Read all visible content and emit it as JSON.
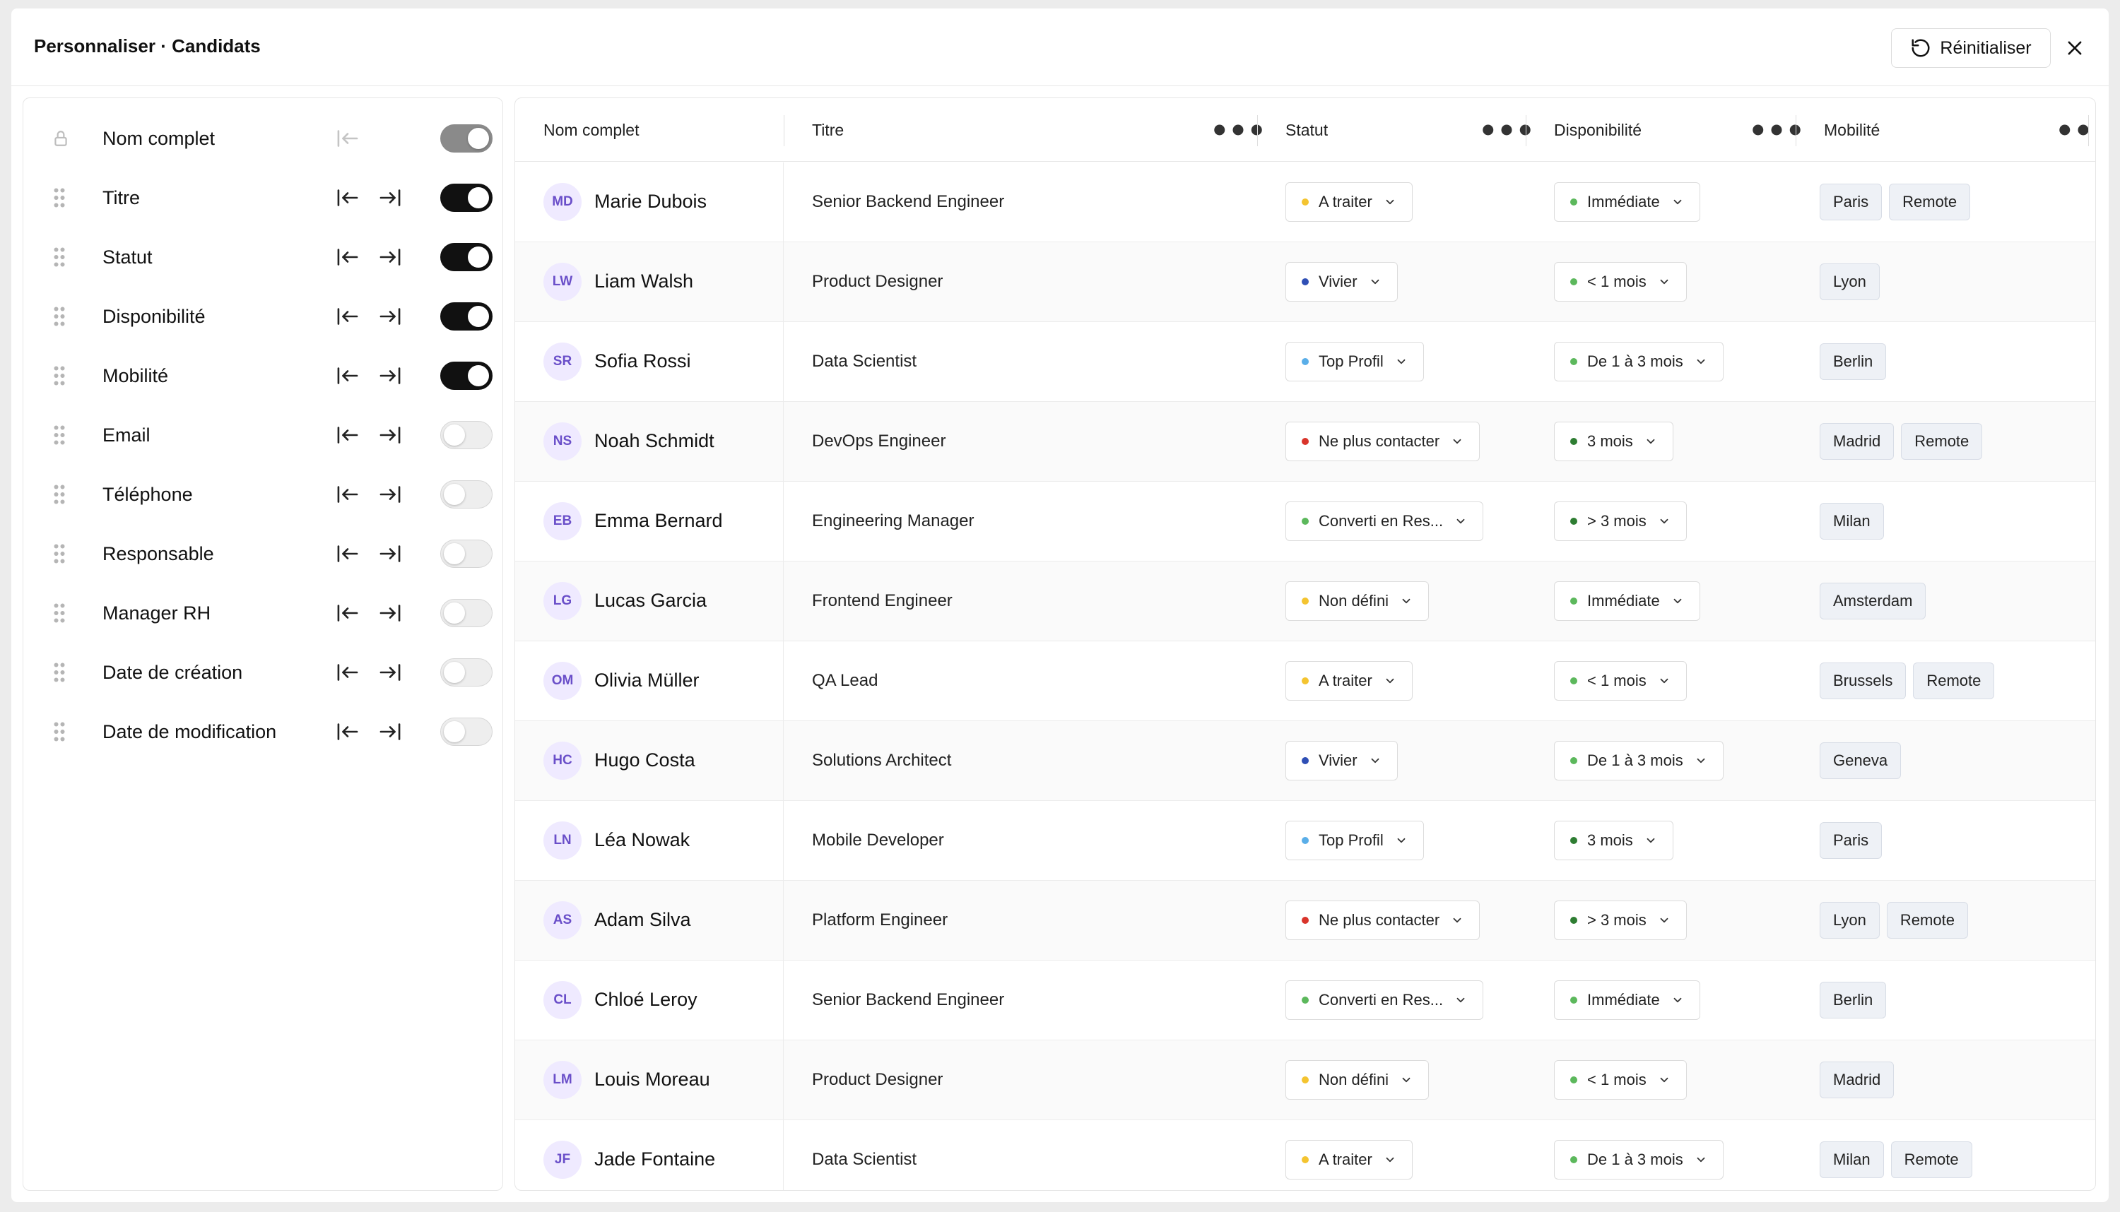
{
  "header": {
    "title": "Personnaliser · Candidats",
    "reset_label": "Réinitialiser"
  },
  "columns_panel": {
    "items": [
      {
        "label": "Nom complet",
        "state": "locked"
      },
      {
        "label": "Titre",
        "state": "on"
      },
      {
        "label": "Statut",
        "state": "on"
      },
      {
        "label": "Disponibilité",
        "state": "on"
      },
      {
        "label": "Mobilité",
        "state": "on"
      },
      {
        "label": "Email",
        "state": "off"
      },
      {
        "label": "Téléphone",
        "state": "off"
      },
      {
        "label": "Responsable",
        "state": "off"
      },
      {
        "label": "Manager RH",
        "state": "off"
      },
      {
        "label": "Date de création",
        "state": "off"
      },
      {
        "label": "Date de modification",
        "state": "off"
      }
    ]
  },
  "table": {
    "headers": {
      "name": "Nom complet",
      "title": "Titre",
      "status": "Statut",
      "availability": "Disponibilité",
      "mobility": "Mobilité"
    },
    "colors": {
      "yellow": "#f4c430",
      "blue": "#2f4fb5",
      "lightblue": "#5aaee8",
      "red": "#d9342b",
      "green": "#5cb85c",
      "darkgreen": "#2e7d32"
    },
    "rows": [
      {
        "initials": "MD",
        "name": "Marie Dubois",
        "title": "Senior Backend Engineer",
        "status": "A traiter",
        "status_color": "yellow",
        "availability": "Immédiate",
        "avail_color": "green",
        "mobility": [
          "Paris",
          "Remote"
        ]
      },
      {
        "initials": "LW",
        "name": "Liam Walsh",
        "title": "Product Designer",
        "status": "Vivier",
        "status_color": "blue",
        "availability": "< 1 mois",
        "avail_color": "green",
        "mobility": [
          "Lyon"
        ]
      },
      {
        "initials": "SR",
        "name": "Sofia Rossi",
        "title": "Data Scientist",
        "status": "Top Profil",
        "status_color": "lightblue",
        "availability": "De 1 à 3 mois",
        "avail_color": "green",
        "mobility": [
          "Berlin"
        ]
      },
      {
        "initials": "NS",
        "name": "Noah Schmidt",
        "title": "DevOps Engineer",
        "status": "Ne plus contacter",
        "status_color": "red",
        "availability": "3 mois",
        "avail_color": "darkgreen",
        "mobility": [
          "Madrid",
          "Remote"
        ]
      },
      {
        "initials": "EB",
        "name": "Emma Bernard",
        "title": "Engineering Manager",
        "status": "Converti en Res...",
        "status_color": "green",
        "availability": "> 3 mois",
        "avail_color": "darkgreen",
        "mobility": [
          "Milan"
        ]
      },
      {
        "initials": "LG",
        "name": "Lucas Garcia",
        "title": "Frontend Engineer",
        "status": "Non défini",
        "status_color": "yellow",
        "availability": "Immédiate",
        "avail_color": "green",
        "mobility": [
          "Amsterdam"
        ]
      },
      {
        "initials": "OM",
        "name": "Olivia Müller",
        "title": "QA Lead",
        "status": "A traiter",
        "status_color": "yellow",
        "availability": "< 1 mois",
        "avail_color": "green",
        "mobility": [
          "Brussels",
          "Remote"
        ]
      },
      {
        "initials": "HC",
        "name": "Hugo Costa",
        "title": "Solutions Architect",
        "status": "Vivier",
        "status_color": "blue",
        "availability": "De 1 à 3 mois",
        "avail_color": "green",
        "mobility": [
          "Geneva"
        ]
      },
      {
        "initials": "LN",
        "name": "Léa Nowak",
        "title": "Mobile Developer",
        "status": "Top Profil",
        "status_color": "lightblue",
        "availability": "3 mois",
        "avail_color": "darkgreen",
        "mobility": [
          "Paris"
        ]
      },
      {
        "initials": "AS",
        "name": "Adam Silva",
        "title": "Platform Engineer",
        "status": "Ne plus contacter",
        "status_color": "red",
        "availability": "> 3 mois",
        "avail_color": "darkgreen",
        "mobility": [
          "Lyon",
          "Remote"
        ]
      },
      {
        "initials": "CL",
        "name": "Chloé Leroy",
        "title": "Senior Backend Engineer",
        "status": "Converti en Res...",
        "status_color": "green",
        "availability": "Immédiate",
        "avail_color": "green",
        "mobility": [
          "Berlin"
        ]
      },
      {
        "initials": "LM",
        "name": "Louis Moreau",
        "title": "Product Designer",
        "status": "Non défini",
        "status_color": "yellow",
        "availability": "< 1 mois",
        "avail_color": "green",
        "mobility": [
          "Madrid"
        ]
      },
      {
        "initials": "JF",
        "name": "Jade Fontaine",
        "title": "Data Scientist",
        "status": "A traiter",
        "status_color": "yellow",
        "availability": "De 1 à 3 mois",
        "avail_color": "green",
        "mobility": [
          "Milan",
          "Remote"
        ]
      }
    ]
  }
}
